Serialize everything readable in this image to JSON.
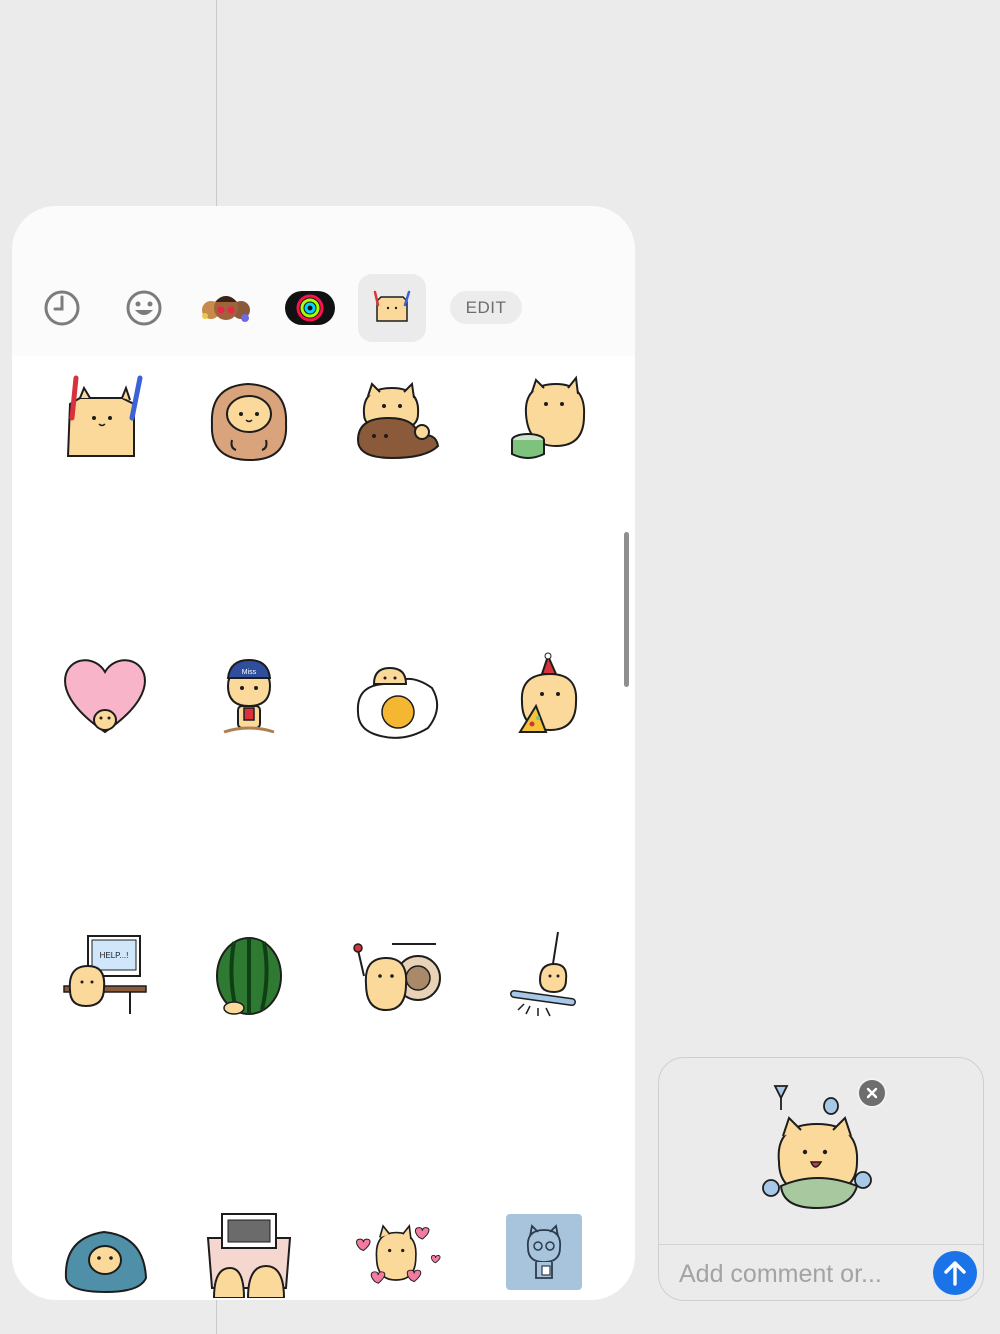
{
  "tabs": [
    {
      "icon": "recent-clock-icon",
      "selected": false
    },
    {
      "icon": "emoji-smiley-icon",
      "selected": false
    },
    {
      "icon": "memoji-faces-icon",
      "selected": false
    },
    {
      "icon": "activity-rings-icon",
      "selected": false
    },
    {
      "icon": "cat-sticker-pack-icon",
      "selected": true
    }
  ],
  "edit_label": "EDIT",
  "sticker_rows": [
    [
      "cat-holding-sticks-sticker",
      "cat-hood-sticker",
      "cat-hugging-bear-sticker",
      "cat-drumming-sticker"
    ],
    [
      "cat-with-heart-sticker",
      "cat-with-cap-sticker",
      "cat-on-egg-sticker",
      "cat-party-pizza-sticker"
    ],
    [
      "cat-computer-help-sticker",
      "watermelon-cat-sticker",
      "cat-gong-sticker",
      "cat-swing-sticker"
    ],
    [
      "cat-blanket-sticker",
      "cats-picture-frame-sticker",
      "cat-hearts-sticker",
      "cat-glasses-sticker"
    ]
  ],
  "computer_help_text": "HELP...!",
  "cap_text": "Miss",
  "compose": {
    "preview_icon": "cat-with-fish-sticker",
    "comment_placeholder": "Add comment or..."
  },
  "colors": {
    "background": "#ebebeb",
    "panel": "#ffffff",
    "send_button": "#1a73e8",
    "cat_fill": "#fbd99a",
    "outline": "#1d1d1d"
  }
}
